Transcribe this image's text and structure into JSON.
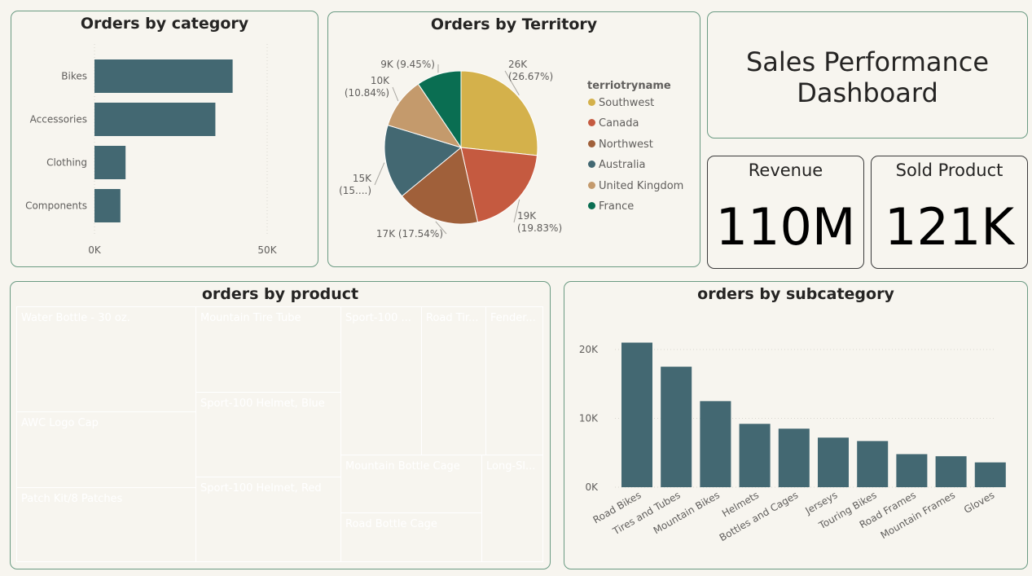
{
  "dashboard": {
    "title_line1": "Sales Performance",
    "title_line2": "Dashboard"
  },
  "kpis": {
    "revenue_label": "Revenue",
    "revenue_value": "110M",
    "sold_label": "Sold Product",
    "sold_value": "121K"
  },
  "category_chart": {
    "title": "Orders by category",
    "bar_color": "#436872",
    "chart_data": {
      "type": "bar",
      "orientation": "horizontal",
      "categories": [
        "Bikes",
        "Accessories",
        "Clothing",
        "Components"
      ],
      "values": [
        40000,
        35000,
        9000,
        7500
      ],
      "xlim": [
        0,
        50000
      ],
      "ticks": [
        {
          "value": 0,
          "label": "0K"
        },
        {
          "value": 50000,
          "label": "50K"
        }
      ],
      "grid": true
    }
  },
  "territory_chart": {
    "title": "Orders by Territory",
    "legend_title": "terriotryname",
    "chart_data": {
      "type": "pie",
      "slices": [
        {
          "name": "Southwest",
          "value": 26.67,
          "label_line1": "26K",
          "label_line2": "(26.67%)",
          "color": "#d4b14b"
        },
        {
          "name": "Canada",
          "value": 19.83,
          "label_line1": "19K",
          "label_line2": "(19.83%)",
          "color": "#c55a40"
        },
        {
          "name": "Northwest",
          "value": 17.54,
          "label_line1": "17K (17.54%)",
          "label_line2": "",
          "color": "#a0603a"
        },
        {
          "name": "Australia",
          "value": 15.67,
          "label_line1": "15K",
          "label_line2": "(15....)",
          "color": "#436872"
        },
        {
          "name": "United Kingdom",
          "value": 10.84,
          "label_line1": "10K",
          "label_line2": "(10.84%)",
          "color": "#c49a6c"
        },
        {
          "name": "France",
          "value": 9.45,
          "label_line1": "9K (9.45%)",
          "label_line2": "",
          "color": "#0a6e52"
        }
      ]
    }
  },
  "product_chart": {
    "title": "orders by product",
    "items": [
      {
        "label": "Water Bottle - 30 oz.",
        "color": "#857c14"
      },
      {
        "label": "AWC Logo Cap",
        "color": "#a8613a"
      },
      {
        "label": "Patch Kit/8 Patches",
        "color": "#636c5e"
      },
      {
        "label": "Mountain Tire Tube",
        "color": "#d4b14b"
      },
      {
        "label": "Sport-100 Helmet, Blue",
        "color": "#1c5b2e"
      },
      {
        "label": "Sport-100 Helmet, Red",
        "color": "#705e70"
      },
      {
        "label": "Sport-100 ...",
        "color": "#594f77"
      },
      {
        "label": "Road Tir...",
        "color": "#838a80"
      },
      {
        "label": "Fender...",
        "color": "#92520e"
      },
      {
        "label": "Mountain Bottle Cage",
        "color": "#436872"
      },
      {
        "label": "Road Bottle Cage",
        "color": "#d4b14b"
      },
      {
        "label": "Long-Sl...",
        "color": "#285a4e"
      }
    ]
  },
  "subcategory_chart": {
    "title": "orders by subcategory",
    "bar_color": "#436872",
    "chart_data": {
      "type": "bar",
      "categories": [
        "Road Bikes",
        "Tires and Tubes",
        "Mountain Bikes",
        "Helmets",
        "Bottles and Cages",
        "Jerseys",
        "Touring Bikes",
        "Road Frames",
        "Mountain Frames",
        "Gloves"
      ],
      "values": [
        21000,
        17500,
        12500,
        9200,
        8500,
        7200,
        6700,
        4800,
        4500,
        3600
      ],
      "ylim": [
        0,
        20000
      ],
      "ticks": [
        {
          "value": 0,
          "label": "0K"
        },
        {
          "value": 10000,
          "label": "10K"
        },
        {
          "value": 20000,
          "label": "20K"
        }
      ],
      "grid": true
    }
  }
}
